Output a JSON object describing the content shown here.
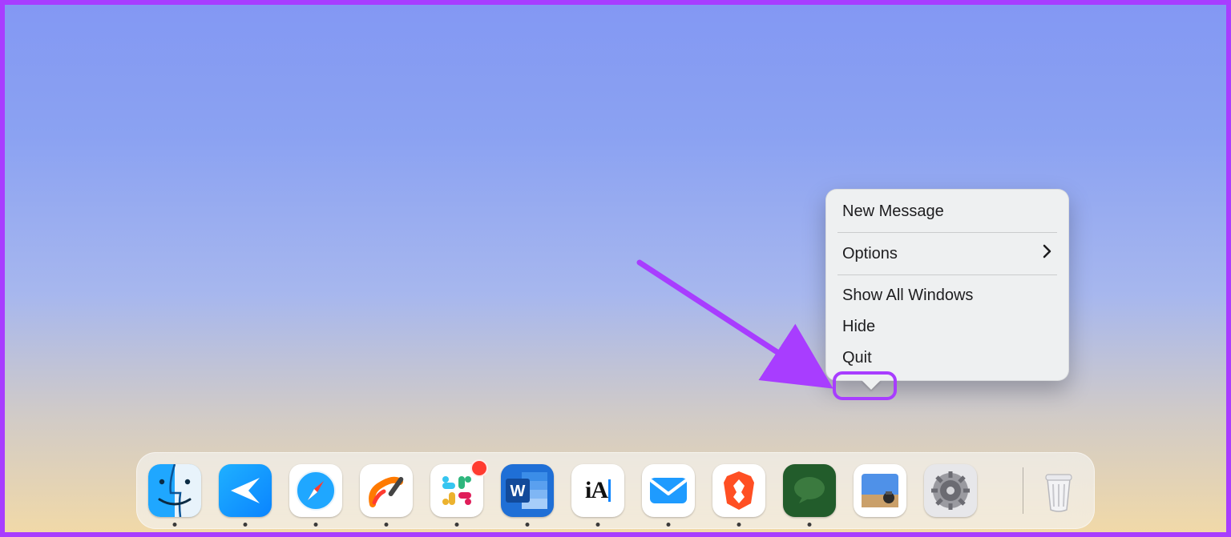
{
  "context_menu": {
    "items": [
      {
        "label": "New Message",
        "has_submenu": false
      },
      {
        "label": "Options",
        "has_submenu": true
      },
      {
        "label": "Show All Windows",
        "has_submenu": false
      },
      {
        "label": "Hide",
        "has_submenu": false
      },
      {
        "label": "Quit",
        "has_submenu": false
      }
    ],
    "highlighted_item": "Quit"
  },
  "dock": {
    "apps": [
      {
        "name": "Finder",
        "running": true,
        "badge": false
      },
      {
        "name": "Spark",
        "running": true,
        "badge": false
      },
      {
        "name": "Safari",
        "running": true,
        "badge": false
      },
      {
        "name": "Freeform",
        "running": true,
        "badge": false
      },
      {
        "name": "Slack",
        "running": true,
        "badge": true
      },
      {
        "name": "Word",
        "running": true,
        "badge": false
      },
      {
        "name": "iA Writer",
        "running": true,
        "badge": false
      },
      {
        "name": "Mail",
        "running": true,
        "badge": false
      },
      {
        "name": "Brave",
        "running": true,
        "badge": false
      },
      {
        "name": "Messages",
        "running": true,
        "badge": false
      },
      {
        "name": "Photos",
        "running": false,
        "badge": false
      },
      {
        "name": "Settings",
        "running": false,
        "badge": false
      }
    ],
    "trash": {
      "name": "Trash"
    }
  },
  "annotation": {
    "border_color": "#a83dff",
    "arrow_target": "Quit"
  }
}
